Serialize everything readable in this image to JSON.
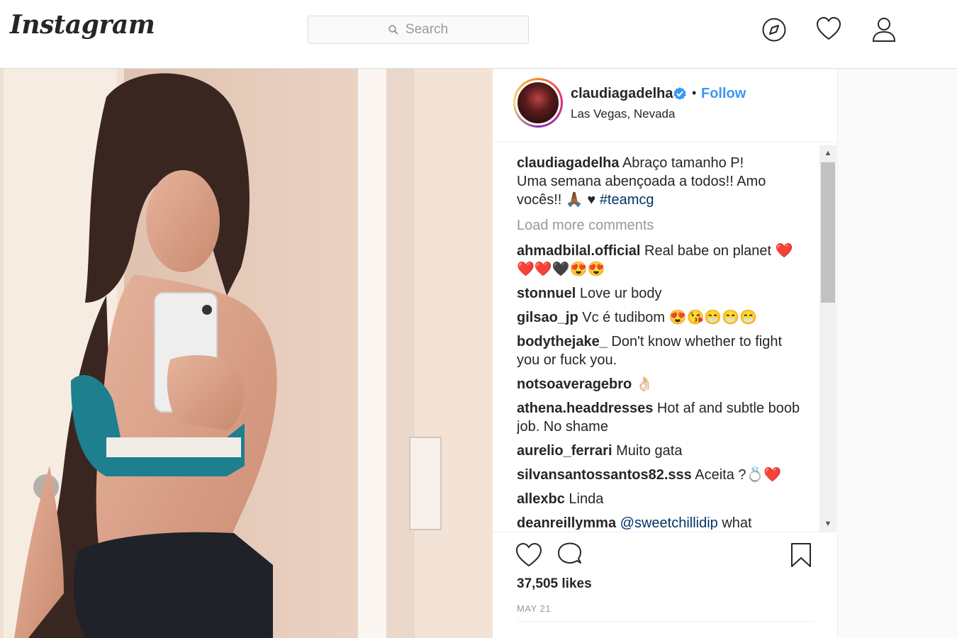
{
  "header": {
    "logo": "Instagram",
    "search_placeholder": "Search",
    "icons": [
      "explore-icon",
      "heart-icon",
      "profile-icon"
    ]
  },
  "post": {
    "username": "claudiagadelha",
    "verified": true,
    "follow_label": "Follow",
    "separator": "•",
    "location": "Las Vegas, Nevada",
    "caption_line1": "Abraço tamanho P!",
    "caption_line2": "Uma semana abençoada a todos!! Amo vocês!! 🙏🏾 ♥",
    "hashtag": "#teamcg",
    "load_more": "Load more comments",
    "comments": [
      {
        "user": "ahmadbilal.official",
        "text": "Real babe on planet ❤️ ❤️❤️🖤😍😍"
      },
      {
        "user": "stonnuel",
        "text": "Love ur body"
      },
      {
        "user": "gilsao_jp",
        "text": "Vc é tudibom 😍😘😁😁😁"
      },
      {
        "user": "bodythejake_",
        "text": "Don't know whether to fight you or fuck you."
      },
      {
        "user": "notsoaveragebro",
        "text": "👌🏻"
      },
      {
        "user": "athena.headdresses",
        "text": "Hot af and subtle boob job. No shame"
      },
      {
        "user": "aurelio_ferrari",
        "text": "Muito gata"
      },
      {
        "user": "silvansantossantos82.sss",
        "text": "Aceita ?💍❤️"
      },
      {
        "user": "allexbc",
        "text": "Linda"
      }
    ],
    "last_comment_user": "deanreillymma",
    "last_comment_mention": "@sweetchillidip",
    "last_comment_text": "what",
    "likes": "37,505 likes",
    "date": "MAY 21"
  },
  "colors": {
    "link_blue": "#3897f0",
    "hashtag_blue": "#003569",
    "border": "#dbdbdb",
    "muted": "#999999"
  }
}
